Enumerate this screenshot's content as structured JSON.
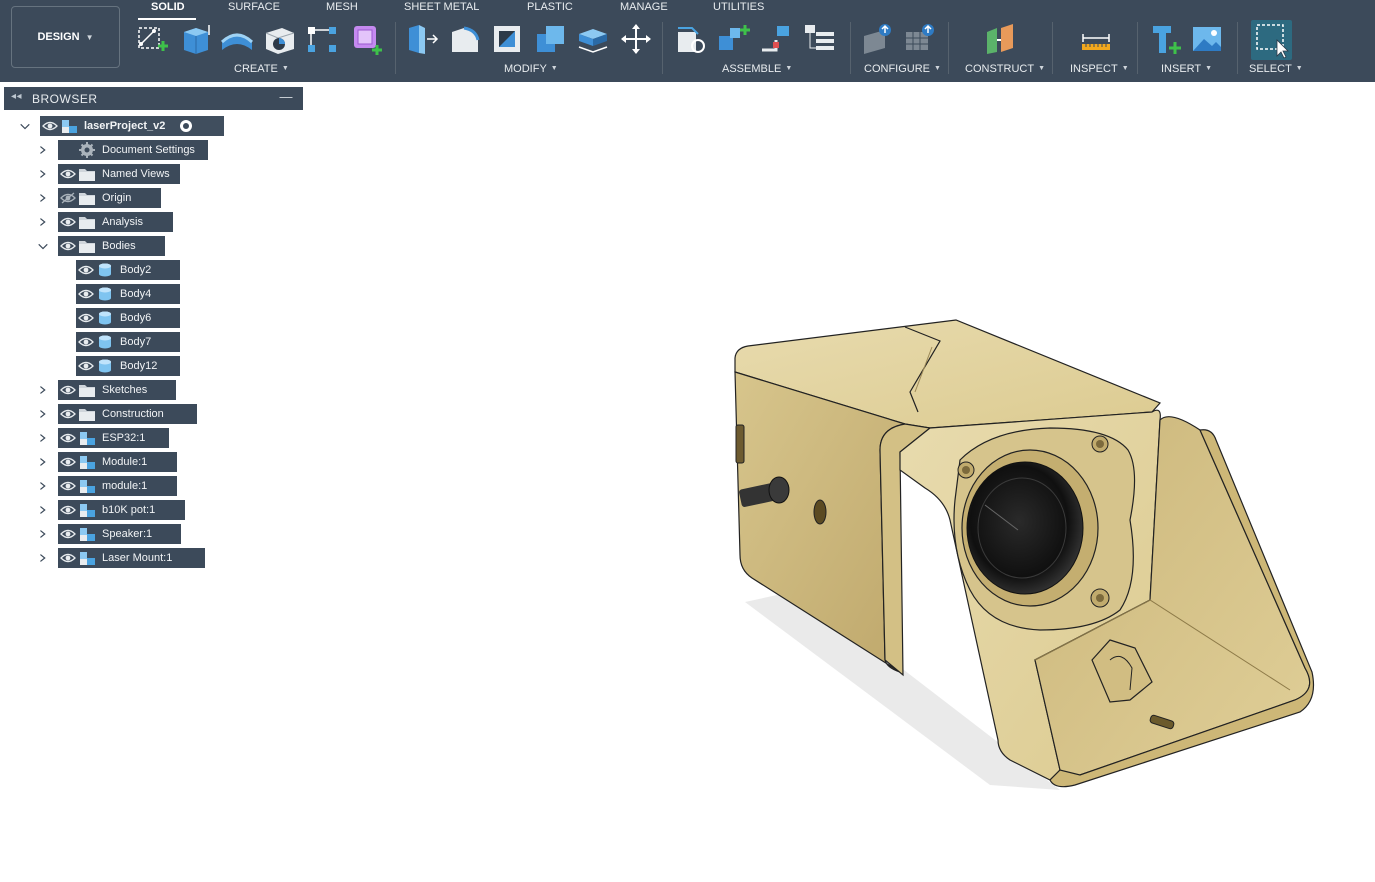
{
  "workspace": {
    "label": "DESIGN"
  },
  "tabs": [
    {
      "label": "SOLID",
      "active": true
    },
    {
      "label": "SURFACE"
    },
    {
      "label": "MESH"
    },
    {
      "label": "SHEET METAL"
    },
    {
      "label": "PLASTIC"
    },
    {
      "label": "MANAGE"
    },
    {
      "label": "UTILITIES"
    }
  ],
  "groups": {
    "create": "CREATE",
    "modify": "MODIFY",
    "assemble": "ASSEMBLE",
    "configure": "CONFIGURE",
    "construct": "CONSTRUCT",
    "inspect": "INSPECT",
    "insert": "INSERT",
    "select": "SELECT"
  },
  "browser": {
    "title": "BROWSER",
    "root": "laserProject_v2",
    "items": [
      {
        "label": "Document Settings",
        "icon": "gear-icon"
      },
      {
        "label": "Named Views",
        "icon": "folder-icon"
      },
      {
        "label": "Origin",
        "icon": "folder-icon",
        "hidden": true
      },
      {
        "label": "Analysis",
        "icon": "folder-icon"
      },
      {
        "label": "Bodies",
        "icon": "folder-icon",
        "expanded": true
      },
      {
        "label": "Body2",
        "icon": "body-icon"
      },
      {
        "label": "Body4",
        "icon": "body-icon"
      },
      {
        "label": "Body6",
        "icon": "body-icon"
      },
      {
        "label": "Body7",
        "icon": "body-icon"
      },
      {
        "label": "Body12",
        "icon": "body-icon"
      },
      {
        "label": "Sketches",
        "icon": "folder-icon"
      },
      {
        "label": "Construction",
        "icon": "folder-icon"
      },
      {
        "label": "ESP32:1",
        "icon": "component-icon"
      },
      {
        "label": "Module:1",
        "icon": "component-icon"
      },
      {
        "label": "module:1",
        "icon": "component-icon"
      },
      {
        "label": "b10K pot:1",
        "icon": "component-icon"
      },
      {
        "label": "Speaker:1",
        "icon": "component-icon"
      },
      {
        "label": "Laser Mount:1",
        "icon": "component-icon"
      }
    ]
  },
  "colors": {
    "toolbar_bg": "#3c4a5a",
    "model_fill": "#e2d3a1",
    "model_shade": "#c9b47a",
    "accent_blue": "#4aa3e0"
  }
}
